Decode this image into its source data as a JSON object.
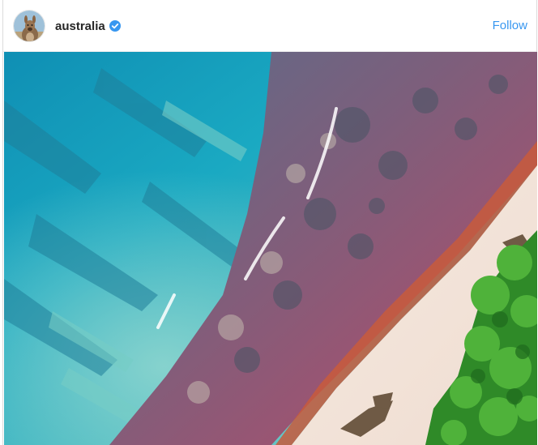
{
  "post": {
    "username": "australia",
    "verified": true,
    "follow_label": "Follow",
    "avatar": "kangaroo-avatar",
    "photo": "aerial-coastline-reef-beach"
  },
  "colors": {
    "accent": "#3897f0",
    "verified_badge": "#3897f0",
    "username": "#262626",
    "ocean": "#1aa3bf",
    "reef": "#a3506e",
    "sand": "#f3e4da",
    "vegetation": "#2e8a2a"
  }
}
